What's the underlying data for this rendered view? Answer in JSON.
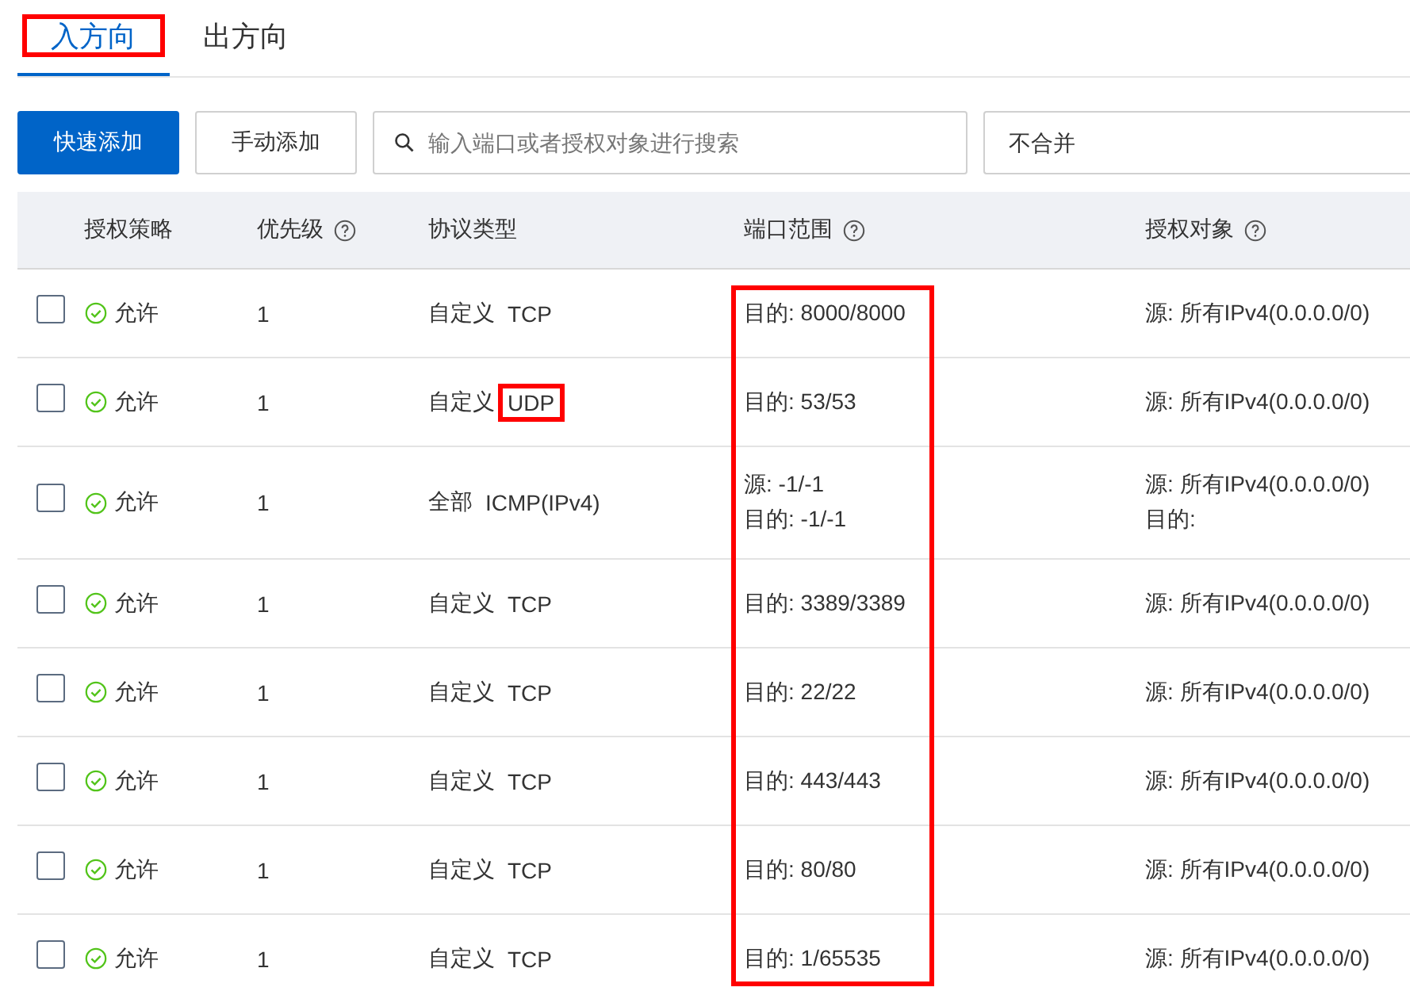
{
  "tabs": [
    {
      "label": "入方向",
      "selected": true,
      "highlighted": true
    },
    {
      "label": "出方向",
      "selected": false,
      "highlighted": false
    }
  ],
  "toolbar": {
    "primary_button": "快速添加",
    "secondary_button": "手动添加",
    "search": {
      "placeholder": "输入端口或者授权对象进行搜索"
    },
    "merge_select": {
      "value": "不合并"
    }
  },
  "table": {
    "port_column_highlighted": true,
    "columns": [
      {
        "label": "授权策略",
        "help": false
      },
      {
        "label": "优先级",
        "help": true
      },
      {
        "label": "协议类型",
        "help": false
      },
      {
        "label": "端口范围",
        "help": true
      },
      {
        "label": "授权对象",
        "help": true
      }
    ],
    "rows": [
      {
        "checked": false,
        "policy": "允许",
        "priority": "1",
        "protocol_scope": "自定义",
        "protocol_name": "TCP",
        "protocol_highlighted": false,
        "port": [
          "目的: 8000/8000"
        ],
        "target": [
          "源: 所有IPv4(0.0.0.0/0)"
        ]
      },
      {
        "checked": false,
        "policy": "允许",
        "priority": "1",
        "protocol_scope": "自定义",
        "protocol_name": "UDP",
        "protocol_highlighted": true,
        "port": [
          "目的: 53/53"
        ],
        "target": [
          "源: 所有IPv4(0.0.0.0/0)"
        ]
      },
      {
        "checked": false,
        "policy": "允许",
        "priority": "1",
        "protocol_scope": "全部",
        "protocol_name": "ICMP(IPv4)",
        "protocol_highlighted": false,
        "port": [
          "源: -1/-1",
          "目的: -1/-1"
        ],
        "target": [
          "源: 所有IPv4(0.0.0.0/0)",
          "目的:"
        ]
      },
      {
        "checked": false,
        "policy": "允许",
        "priority": "1",
        "protocol_scope": "自定义",
        "protocol_name": "TCP",
        "protocol_highlighted": false,
        "port": [
          "目的: 3389/3389"
        ],
        "target": [
          "源: 所有IPv4(0.0.0.0/0)"
        ]
      },
      {
        "checked": false,
        "policy": "允许",
        "priority": "1",
        "protocol_scope": "自定义",
        "protocol_name": "TCP",
        "protocol_highlighted": false,
        "port": [
          "目的: 22/22"
        ],
        "target": [
          "源: 所有IPv4(0.0.0.0/0)"
        ]
      },
      {
        "checked": false,
        "policy": "允许",
        "priority": "1",
        "protocol_scope": "自定义",
        "protocol_name": "TCP",
        "protocol_highlighted": false,
        "port": [
          "目的: 443/443"
        ],
        "target": [
          "源: 所有IPv4(0.0.0.0/0)"
        ]
      },
      {
        "checked": false,
        "policy": "允许",
        "priority": "1",
        "protocol_scope": "自定义",
        "protocol_name": "TCP",
        "protocol_highlighted": false,
        "port": [
          "目的: 80/80"
        ],
        "target": [
          "源: 所有IPv4(0.0.0.0/0)"
        ]
      },
      {
        "checked": false,
        "policy": "允许",
        "priority": "1",
        "protocol_scope": "自定义",
        "protocol_name": "TCP",
        "protocol_highlighted": false,
        "port": [
          "目的: 1/65535"
        ],
        "target": [
          "源: 所有IPv4(0.0.0.0/0)"
        ]
      }
    ]
  }
}
